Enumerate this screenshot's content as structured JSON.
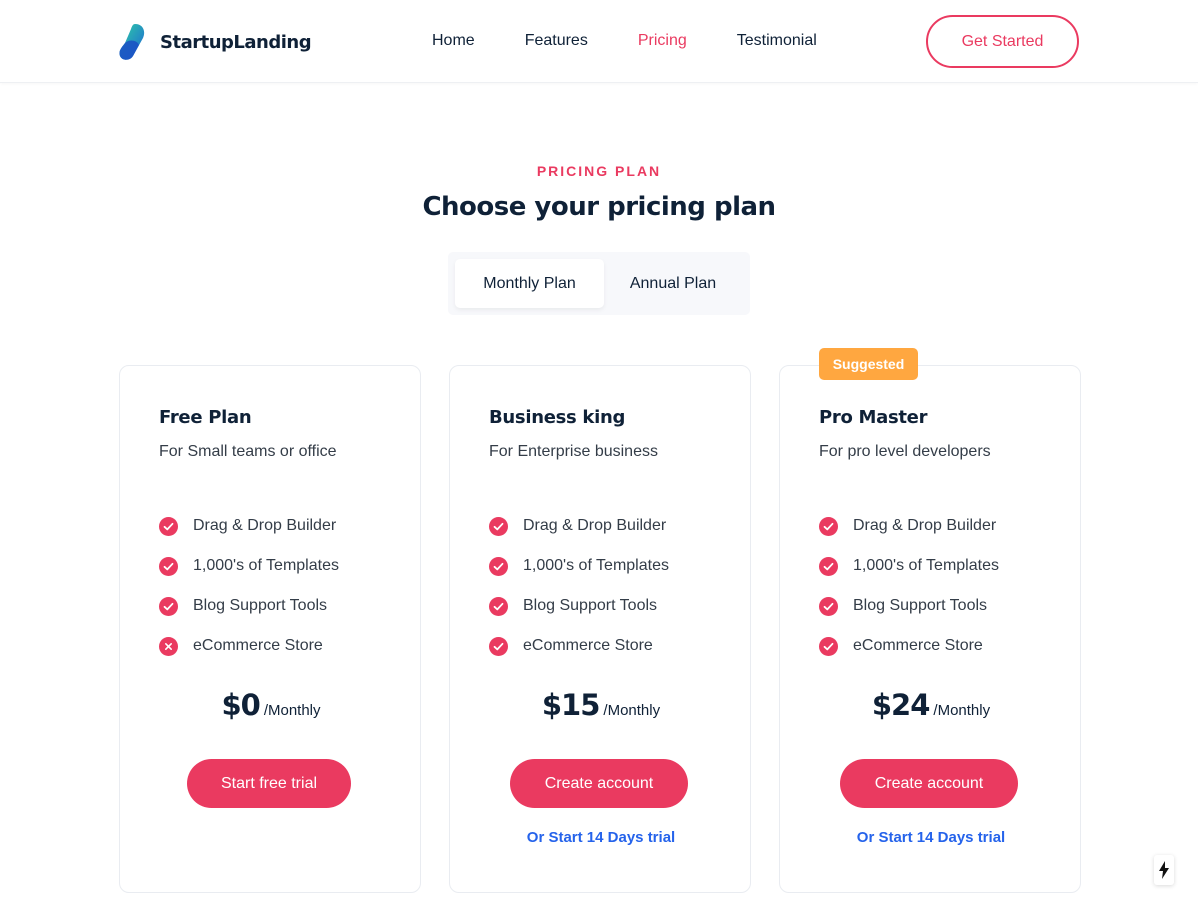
{
  "brand": {
    "name": "StartupLanding"
  },
  "nav": {
    "items": [
      {
        "label": "Home",
        "active": false
      },
      {
        "label": "Features",
        "active": false
      },
      {
        "label": "Pricing",
        "active": true
      },
      {
        "label": "Testimonial",
        "active": false
      }
    ],
    "cta_label": "Get Started"
  },
  "section": {
    "eyebrow": "PRICING PLAN",
    "title": "Choose your pricing plan",
    "toggle": {
      "monthly": "Monthly Plan",
      "annual": "Annual Plan",
      "selected": "monthly"
    }
  },
  "colors": {
    "accent": "#ea3a60",
    "link": "#2563eb",
    "badge": "#ffa740",
    "text": "#0f2137"
  },
  "plans": [
    {
      "name": "Free Plan",
      "subtitle": "For Small teams or office",
      "features": [
        {
          "label": "Drag & Drop Builder",
          "included": true,
          "icon": "check-circle-icon"
        },
        {
          "label": "1,000's of Templates",
          "included": true,
          "icon": "check-circle-icon"
        },
        {
          "label": "Blog Support Tools",
          "included": true,
          "icon": "check-circle-icon"
        },
        {
          "label": "eCommerce Store",
          "included": false,
          "icon": "x-circle-icon"
        }
      ],
      "price": "$0",
      "period": "/Monthly",
      "button": "Start free trial",
      "trial": ""
    },
    {
      "name": "Business king",
      "subtitle": "For Enterprise business",
      "features": [
        {
          "label": "Drag & Drop Builder",
          "included": true,
          "icon": "check-circle-icon"
        },
        {
          "label": "1,000's of Templates",
          "included": true,
          "icon": "check-circle-icon"
        },
        {
          "label": "Blog Support Tools",
          "included": true,
          "icon": "check-circle-icon"
        },
        {
          "label": "eCommerce Store",
          "included": true,
          "icon": "check-circle-icon"
        }
      ],
      "price": "$15",
      "period": "/Monthly",
      "button": "Create account",
      "trial": "Or Start 14 Days trial"
    },
    {
      "badge": "Suggested",
      "name": "Pro Master",
      "subtitle": "For pro level developers",
      "features": [
        {
          "label": "Drag & Drop Builder",
          "included": true,
          "icon": "check-circle-icon"
        },
        {
          "label": "1,000's of Templates",
          "included": true,
          "icon": "check-circle-icon"
        },
        {
          "label": "Blog Support Tools",
          "included": true,
          "icon": "check-circle-icon"
        },
        {
          "label": "eCommerce Store",
          "included": true,
          "icon": "check-circle-icon"
        }
      ],
      "price": "$24",
      "period": "/Monthly",
      "button": "Create account",
      "trial": "Or Start 14 Days trial"
    }
  ],
  "floating": {
    "icon": "lightning-bolt-icon"
  }
}
